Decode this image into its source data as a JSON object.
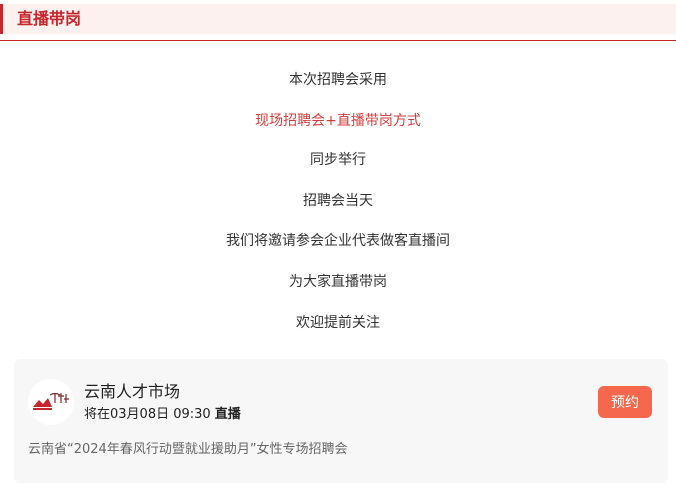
{
  "section": {
    "title": "直播带岗"
  },
  "announcement": {
    "lines": [
      "本次招聘会采用",
      "现场招聘会+直播带岗方式",
      "同步举行",
      "招聘会当天",
      "我们将邀请参会企业代表做客直播间",
      "为大家直播带岗",
      "欢迎提前关注"
    ]
  },
  "live_card": {
    "org_name": "云南人才市场",
    "logo_text": "云南人才市场",
    "schedule_prefix": "将在03月08日 09:30",
    "schedule_live": "直播",
    "reserve_label": "预约",
    "description": "云南省“2024年春风行动暨就业援助月”女性专场招聘会"
  },
  "colors": {
    "accent": "#c6262c",
    "highlight_text": "#d23e3b",
    "reserve_button": "#f5684d",
    "header_bg": "#fdf1ef",
    "card_bg": "#f7f7f7"
  }
}
